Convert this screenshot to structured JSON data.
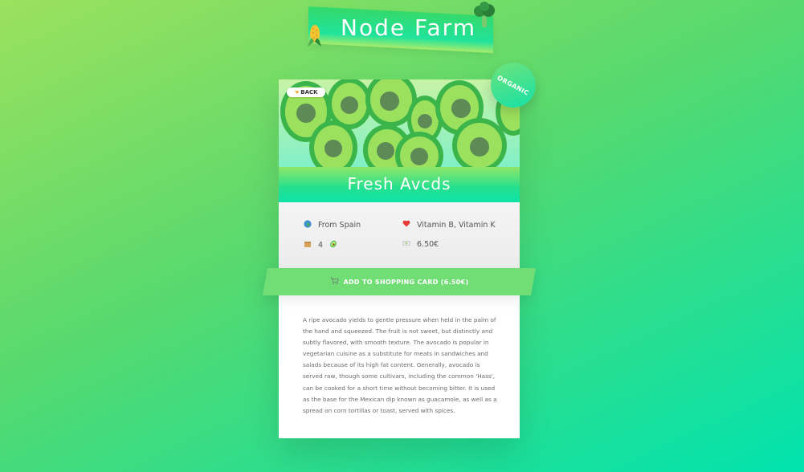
{
  "brand": {
    "title": "Node Farm",
    "left_icon": "corn-icon",
    "right_icon": "broccoli-icon"
  },
  "product": {
    "back_label": "BACK",
    "back_icon": "hand-pointing-left-icon",
    "badge": "ORGANIC",
    "name": "Fresh Avcds",
    "origin_icon": "globe-icon",
    "origin": "From Spain",
    "nutrients_icon": "heart-icon",
    "nutrients": "Vitamin B, Vitamin K",
    "quantity_icon": "box-icon",
    "quantity": "4",
    "quantity_unit_icon": "avocado-icon",
    "price_icon": "money-icon",
    "price": "6.50€",
    "add_to_cart_icon": "cart-icon",
    "add_to_cart": "ADD TO SHOPPING CARD (6.50€)",
    "description": "A ripe avocado yields to gentle pressure when held in the palm of the hand and squeezed. The fruit is not sweet, but distinctly and subtly flavored, with smooth texture. The avocado is popular in vegetarian cuisine as a substitute for meats in sandwiches and salads because of its high fat content. Generally, avocado is served raw, though some cultivars, including the common 'Hass', can be cooked for a short time without becoming bitter. It is used as the base for the Mexican dip known as guacamole, as well as a spread on corn tortillas or toast, served with spices."
  },
  "colors": {
    "accent_green": "#70de75",
    "title_gradient_end": "#0fe3a8",
    "avocado_skin": "#3bb54a",
    "avocado_flesh": "#9be15d",
    "avocado_pit": "#5e8a56"
  }
}
